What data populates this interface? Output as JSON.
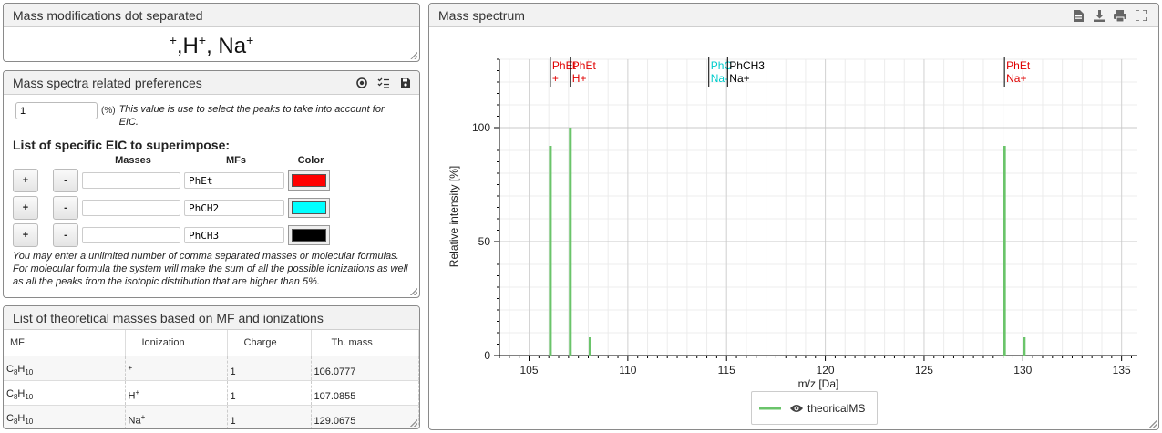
{
  "mass_mod_panel": {
    "title": "Mass modifications dot separated",
    "parts": [
      {
        "base": "",
        "sup": "+"
      },
      {
        "base": ",H",
        "sup": "+"
      },
      {
        "base": ", Na",
        "sup": "+"
      }
    ]
  },
  "prefs_panel": {
    "title": "Mass spectra related preferences",
    "icons": [
      "circle-icon",
      "checklist-icon",
      "save-icon"
    ],
    "threshold_value": "1",
    "threshold_unit": "(%)",
    "threshold_help": "This value is use to select the peaks to take into account for EIC.",
    "eic_title": "List of specific EIC to superimpose:",
    "columns": {
      "masses": "Masses",
      "mfs": "MFs",
      "color": "Color"
    },
    "plus_label": "+",
    "minus_label": "-",
    "rows": [
      {
        "mass": "",
        "mf": "PhEt",
        "color": "#ff0000"
      },
      {
        "mass": "",
        "mf": "PhCH2",
        "color": "#00ffff"
      },
      {
        "mass": "",
        "mf": "PhCH3",
        "color": "#000000"
      }
    ],
    "note": "You may enter a unlimited number of comma separated masses or molecular formulas. For molecular formula the system will make the sum of all the possible ionizations as well as all the peaks from the isotopic distribution that are higher than 5%."
  },
  "theoretical_panel": {
    "title": "List of theoretical masses based on MF and ionizations",
    "columns": [
      "MF",
      "Ionization",
      "Charge",
      "Th. mass"
    ],
    "rows": [
      {
        "mf": "C",
        "mf_n1": "8",
        "mf_b": "H",
        "mf_n2": "10",
        "ion_base": "",
        "ion_sup": "+",
        "charge": "1",
        "mass": "106.0777"
      },
      {
        "mf": "C",
        "mf_n1": "8",
        "mf_b": "H",
        "mf_n2": "10",
        "ion_base": "H",
        "ion_sup": "+",
        "charge": "1",
        "mass": "107.0855"
      },
      {
        "mf": "C",
        "mf_n1": "8",
        "mf_b": "H",
        "mf_n2": "10",
        "ion_base": "Na",
        "ion_sup": "+",
        "charge": "1",
        "mass": "129.0675"
      }
    ]
  },
  "spectrum_panel": {
    "title": "Mass spectrum",
    "icons": [
      "file-icon",
      "download-icon",
      "print-icon",
      "fullscreen-icon"
    ],
    "legend_label": "theoricalMS",
    "legend_color": "#6ac46a"
  },
  "chart_data": {
    "type": "bar",
    "xlabel": "m/z [Da]",
    "ylabel": "Relative intensity [%]",
    "xlim": [
      103.5,
      135.8
    ],
    "ylim": [
      0,
      130
    ],
    "x_ticks": [
      105,
      110,
      115,
      120,
      125,
      130,
      135
    ],
    "y_ticks": [
      0,
      50,
      100
    ],
    "grid": true,
    "series": [
      {
        "name": "theoricalMS",
        "color": "#6ac46a",
        "x": [
          106.08,
          107.09,
          108.09,
          129.07,
          130.07
        ],
        "values": [
          92,
          100,
          8,
          92,
          8
        ]
      }
    ],
    "annotations": [
      {
        "x": 106.08,
        "lines": [
          "PhEt",
          "+"
        ],
        "colors": [
          "#e00000",
          "#e00000"
        ]
      },
      {
        "x": 107.09,
        "lines": [
          "PhEt",
          "H+"
        ],
        "colors": [
          "#e00000",
          "#e00000"
        ]
      },
      {
        "x": 114.1,
        "lines": [
          "PhC",
          "Na-"
        ],
        "colors": [
          "#00cccc",
          "#00cccc"
        ]
      },
      {
        "x": 115.05,
        "lines": [
          "PhCH3",
          "Na+"
        ],
        "colors": [
          "#000000",
          "#000000"
        ]
      },
      {
        "x": 129.07,
        "lines": [
          "PhEt",
          "Na+"
        ],
        "colors": [
          "#e00000",
          "#e00000"
        ]
      }
    ]
  }
}
